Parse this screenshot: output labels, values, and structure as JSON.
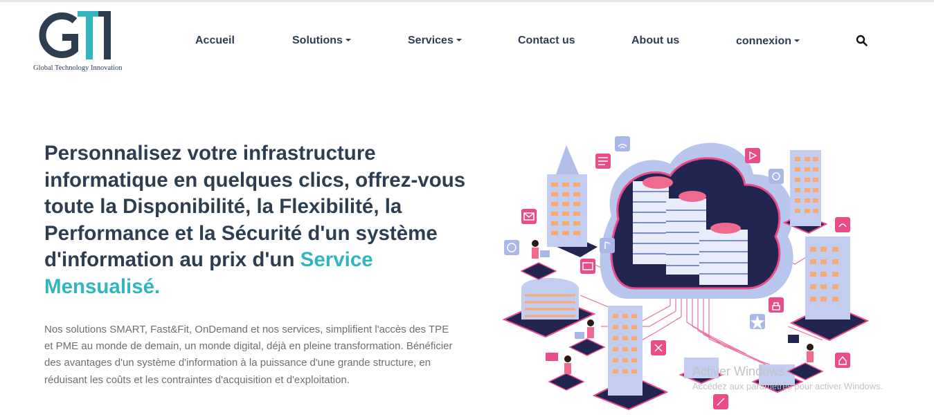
{
  "brand": {
    "logo_text": "GTI",
    "tagline": "Global Technology Innovation"
  },
  "nav": {
    "items": [
      {
        "label": "Accueil",
        "dropdown": false
      },
      {
        "label": "Solutions",
        "dropdown": true
      },
      {
        "label": "Services",
        "dropdown": true
      },
      {
        "label": "Contact us",
        "dropdown": false
      },
      {
        "label": "About us",
        "dropdown": false
      },
      {
        "label": "connexion",
        "dropdown": true
      }
    ],
    "search_icon": "search-icon"
  },
  "hero": {
    "headline_main": "Personnalisez votre infrastructure informatique en quelques clics, offrez-vous toute la Disponibilité, la Flexibilité, la Performance et la Sécurité d'un système d'information au prix d'un ",
    "headline_accent": "Service Mensualisé.",
    "lead": "Nos solutions SMART, Fast&Fit, OnDemand et nos services, simplifient l'accès des TPE et PME au monde de demain, un monde digital, déjà en pleine transformation. Bénéficier des avantages d'un système d'information à la puissance d'une grande structure, en réduisant les coûts et les contraintes d'acquisition et d'exploitation."
  },
  "watermark": {
    "line1": "Activer Windows",
    "line2": "Accédez aux paramètres pour activer Windows."
  },
  "colors": {
    "text_dark": "#2d3e50",
    "accent_teal": "#2fb6bf",
    "illustration_pink": "#ea4c89",
    "illustration_blue": "#a9b8e8",
    "illustration_navy": "#232551"
  }
}
